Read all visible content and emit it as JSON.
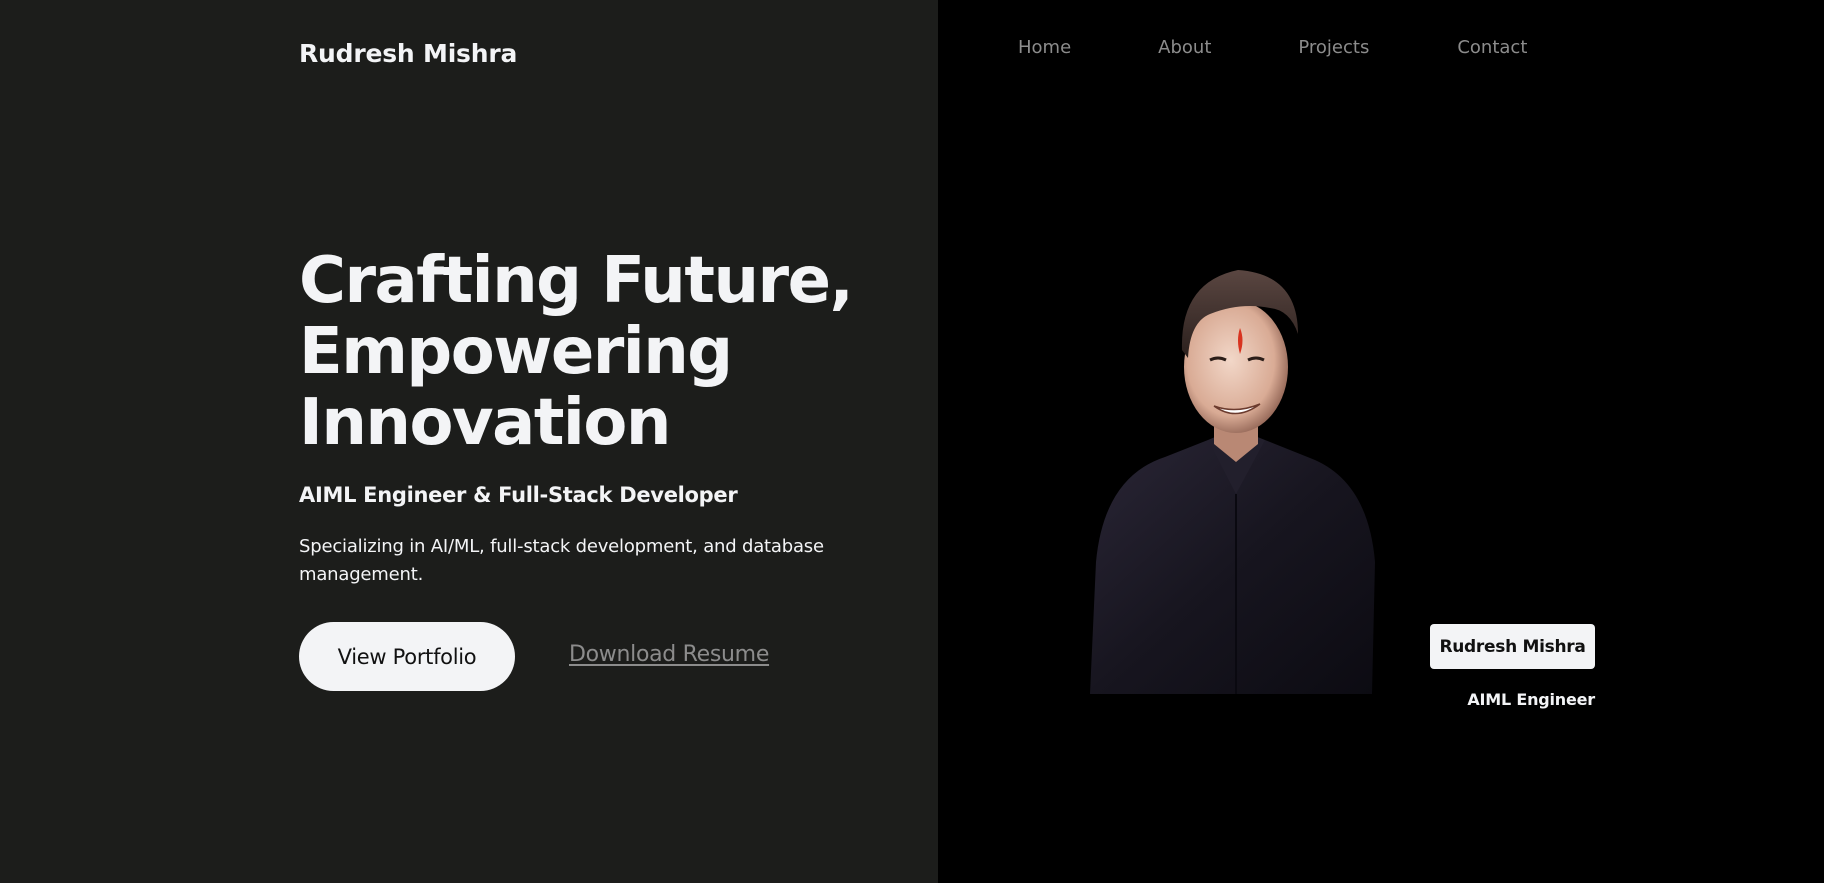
{
  "header": {
    "brand": "Rudresh Mishra",
    "nav": [
      "Home",
      "About",
      "Projects",
      "Contact"
    ]
  },
  "hero": {
    "title_lines": [
      "Crafting Future,",
      "Empowering",
      "Innovation"
    ],
    "role": "AIML Engineer & Full-Stack Developer",
    "description": "Specializing in AI/ML, full-stack development, and database management.",
    "primary_button": "View Portfolio",
    "secondary_link": "Download Resume"
  },
  "profile": {
    "name": "Rudresh Mishra",
    "title": "AIML Engineer"
  },
  "colors": {
    "left_background": "#1c1d1b",
    "right_background": "#000000",
    "text": "#f3f4f6",
    "muted": "#8c8c8c"
  }
}
